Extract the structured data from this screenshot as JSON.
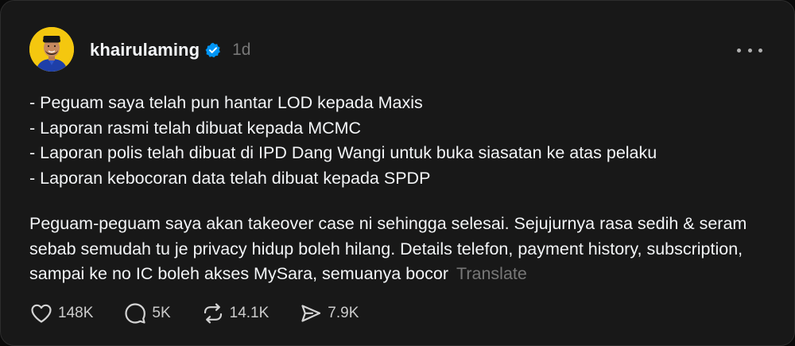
{
  "post": {
    "author": {
      "username": "khairulaming",
      "verified": true,
      "avatar": "avatar-photo"
    },
    "timestamp": "1d",
    "more_icon": "more-horizontal-icon",
    "bullets": [
      "- Peguam saya telah pun hantar LOD kepada Maxis",
      "- Laporan rasmi telah dibuat kepada MCMC",
      "- Laporan polis telah dibuat di IPD Dang Wangi untuk buka siasatan ke atas pelaku",
      "- Laporan kebocoran data telah dibuat kepada SPDP"
    ],
    "paragraph": "Peguam-peguam saya akan takeover case ni sehingga selesai. Sejujurnya rasa sedih & seram sebab semudah tu je privacy hidup boleh hilang. Details telefon, payment history, subscription, sampai ke no IC boleh akses MySara, semuanya bocor",
    "translate_label": "Translate",
    "actions": {
      "like": {
        "icon": "heart-icon",
        "count": "148K"
      },
      "reply": {
        "icon": "comment-icon",
        "count": "5K"
      },
      "repost": {
        "icon": "repost-icon",
        "count": "14.1K"
      },
      "share": {
        "icon": "send-icon",
        "count": "7.9K"
      }
    }
  },
  "colors": {
    "background": "#181818",
    "text": "#f3f5f7",
    "muted": "#777777",
    "verified_badge": "#0095f6",
    "avatar_bg": "#f4c70f"
  }
}
